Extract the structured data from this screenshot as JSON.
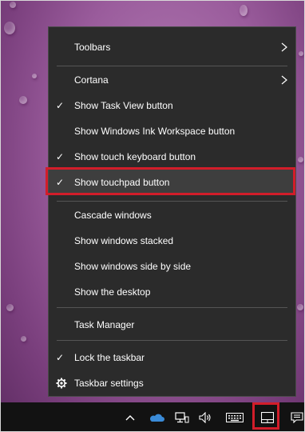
{
  "menu": {
    "items": [
      {
        "label": "Toolbars",
        "checked": false,
        "submenu": true
      },
      {
        "label": "Cortana",
        "checked": false,
        "submenu": true
      },
      {
        "label": "Show Task View button",
        "checked": true
      },
      {
        "label": "Show Windows Ink Workspace button",
        "checked": false
      },
      {
        "label": "Show touch keyboard button",
        "checked": true
      },
      {
        "label": "Show touchpad button",
        "checked": true,
        "highlighted": true
      },
      {
        "label": "Cascade windows",
        "checked": false
      },
      {
        "label": "Show windows stacked",
        "checked": false
      },
      {
        "label": "Show windows side by side",
        "checked": false
      },
      {
        "label": "Show the desktop",
        "checked": false
      },
      {
        "label": "Task Manager",
        "checked": false
      },
      {
        "label": "Lock the taskbar",
        "checked": true
      },
      {
        "label": "Taskbar settings",
        "icon": "gear-icon"
      }
    ]
  },
  "taskbar": {
    "icons": [
      "chevron-up-icon",
      "onedrive-cloud-icon",
      "network-icon",
      "volume-icon",
      "touch-keyboard-icon",
      "touchpad-icon",
      "action-center-icon"
    ]
  },
  "colors": {
    "highlight_box": "#d21d2a",
    "menu_bg": "#2b2b2b",
    "taskbar_bg": "#121212"
  }
}
